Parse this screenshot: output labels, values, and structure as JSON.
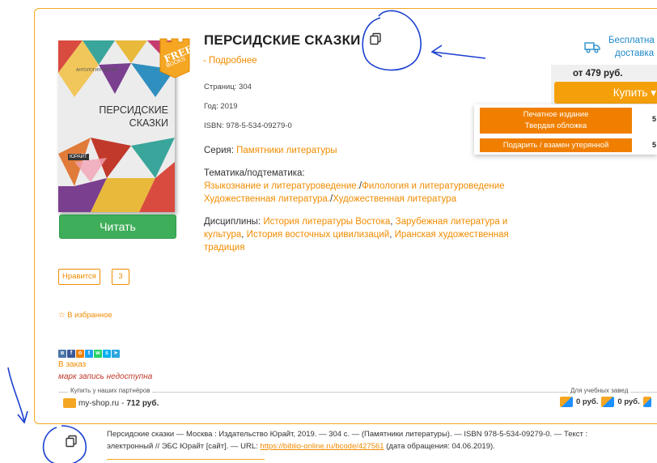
{
  "book": {
    "title": "ПЕРСИДСКИЕ СКАЗКИ",
    "more_link": "- Подробнее",
    "pages": "Страниц: 304",
    "year": "Год: 2019",
    "isbn": "ISBN: 978-5-534-09279-0",
    "series_label": "Серия: ",
    "series_value": "Памятники литературы",
    "topics_label": "Тематика/подтематика:",
    "topic_line1_a": "Языкознание и литературоведение.",
    "topic_line1_b": "Филология и литературоведение",
    "topic_line2_a": "Художественная литература.",
    "topic_line2_b": "Художественная литература",
    "disciplines_label": "Дисциплины: ",
    "disc_1": "История литературы Востока",
    "disc_2": "Зарубежная литература и культура",
    "disc_3": "История восточных цивилизаций",
    "disc_4": "Иранская художественная традиция",
    "cover_series": "АНТОЛОГИЯ МЫСЛИ",
    "cover_title_1": "ПЕРСИДСКИЕ",
    "cover_title_2": "СКАЗКИ",
    "cover_publisher": "ЮРАЙТ",
    "badge_top": "FREE",
    "badge_bottom": "BOOKS"
  },
  "actions": {
    "read": "Читать",
    "like": "Нравится",
    "like_count": "3",
    "favorite": "В избранное",
    "order": "В заказ",
    "unavailable": "марк запись недоступна"
  },
  "social": [
    "vk",
    "fb",
    "ok",
    "tw",
    "wa",
    "sk",
    "tg"
  ],
  "partners": {
    "label": "Купить у наших партнёров",
    "shop_name": "my-shop.ru",
    "shop_price": "712 руб."
  },
  "edu": {
    "label": "Для учебных завед",
    "price_1": "0 руб.",
    "price_2": "0 руб."
  },
  "purchase": {
    "delivery_line1": "Бесплатна",
    "delivery_line2": "доставка",
    "price": "от 479 руб.",
    "buy": "Купить ▾",
    "option1_line1": "Печатное издание",
    "option1_line2": "Твердая обложка",
    "option2": "Подарить / взамен утерянной",
    "side1": "5",
    "side2": "5"
  },
  "citation": {
    "text_line1": "Персидские сказки — Москва : Издательство Юрайт, 2019. — 304 с. — (Памятники литературы). — ISBN 978-5-534-09279-0. — Текст :",
    "text_line2_pre": "электронный // ЭБС Юрайт [сайт]. — URL: ",
    "url": "https://biblio-online.ru/bcode/427561",
    "text_line2_post": " (дата обращения: 04.06.2019)."
  },
  "colors": {
    "accent": "#f08c00",
    "read_button": "#3fae5a",
    "link_blue": "#1e88c9",
    "annotation": "#1a3fcf"
  }
}
